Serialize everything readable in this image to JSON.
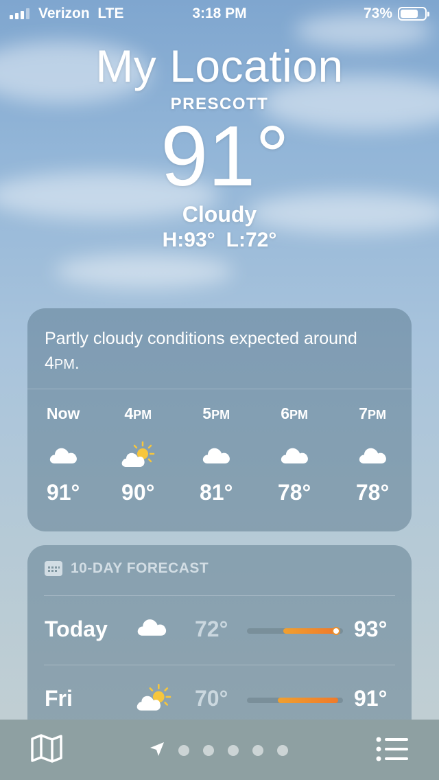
{
  "status_bar": {
    "carrier": "Verizon  LTE",
    "time": "3:18 PM",
    "battery": "73%",
    "battery_level": 0.73
  },
  "header": {
    "title": "My Location",
    "city": "PRESCOTT",
    "temperature": "91°",
    "condition": "Cloudy",
    "high": "H:93°",
    "low": "L:72°"
  },
  "hourly": {
    "summary_main": "Partly cloudy conditions expected around 4",
    "summary_pm": "PM",
    "summary_end": ".",
    "hours": [
      {
        "label": "Now",
        "suffix": "",
        "icon": "cloud-icon",
        "temp": "91°"
      },
      {
        "label": "4",
        "suffix": "PM",
        "icon": "partly-sunny-icon",
        "temp": "90°"
      },
      {
        "label": "5",
        "suffix": "PM",
        "icon": "cloud-icon",
        "temp": "81°"
      },
      {
        "label": "6",
        "suffix": "PM",
        "icon": "cloud-icon",
        "temp": "78°"
      },
      {
        "label": "7",
        "suffix": "PM",
        "icon": "cloud-icon",
        "temp": "78°"
      }
    ]
  },
  "forecast": {
    "heading": "10-DAY FORECAST",
    "days": [
      {
        "day": "Today",
        "icon": "cloud-icon",
        "low": "72°",
        "high": "93°",
        "range_start": 0.38,
        "range_end": 0.93,
        "current_pos": 0.93
      },
      {
        "day": "Fri",
        "icon": "partly-sunny-icon",
        "low": "70°",
        "high": "91°",
        "range_start": 0.32,
        "range_end": 0.95
      }
    ]
  },
  "bottom_bar": {
    "page_count": 5,
    "icons": [
      "map-icon",
      "location-arrow-icon",
      "list-icon"
    ]
  }
}
